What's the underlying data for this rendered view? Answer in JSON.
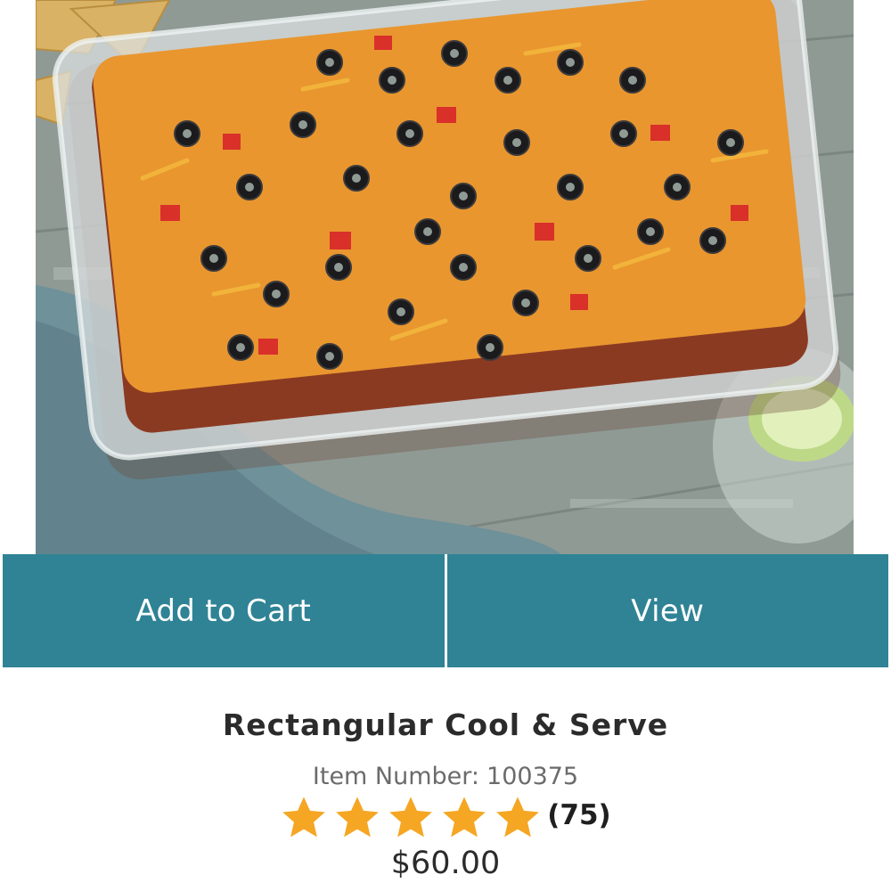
{
  "product": {
    "image_alt": "Rectangular Cool & Serve dish with layered dip",
    "title": "Rectangular Cool & Serve",
    "item_number_label": "Item Number:",
    "item_number": "100375",
    "rating_stars": 5,
    "rating_max": 5,
    "review_count": "(75)",
    "price": "$60.00"
  },
  "actions": {
    "add_to_cart_label": "Add to Cart",
    "view_label": "View"
  },
  "colors": {
    "button_background": "#2f8395",
    "button_text": "#ffffff",
    "star_fill": "#f5a623",
    "title_text": "#2b2b2b",
    "secondary_text": "#6b6b6b"
  },
  "icons": {
    "rating_star": "star-icon"
  }
}
